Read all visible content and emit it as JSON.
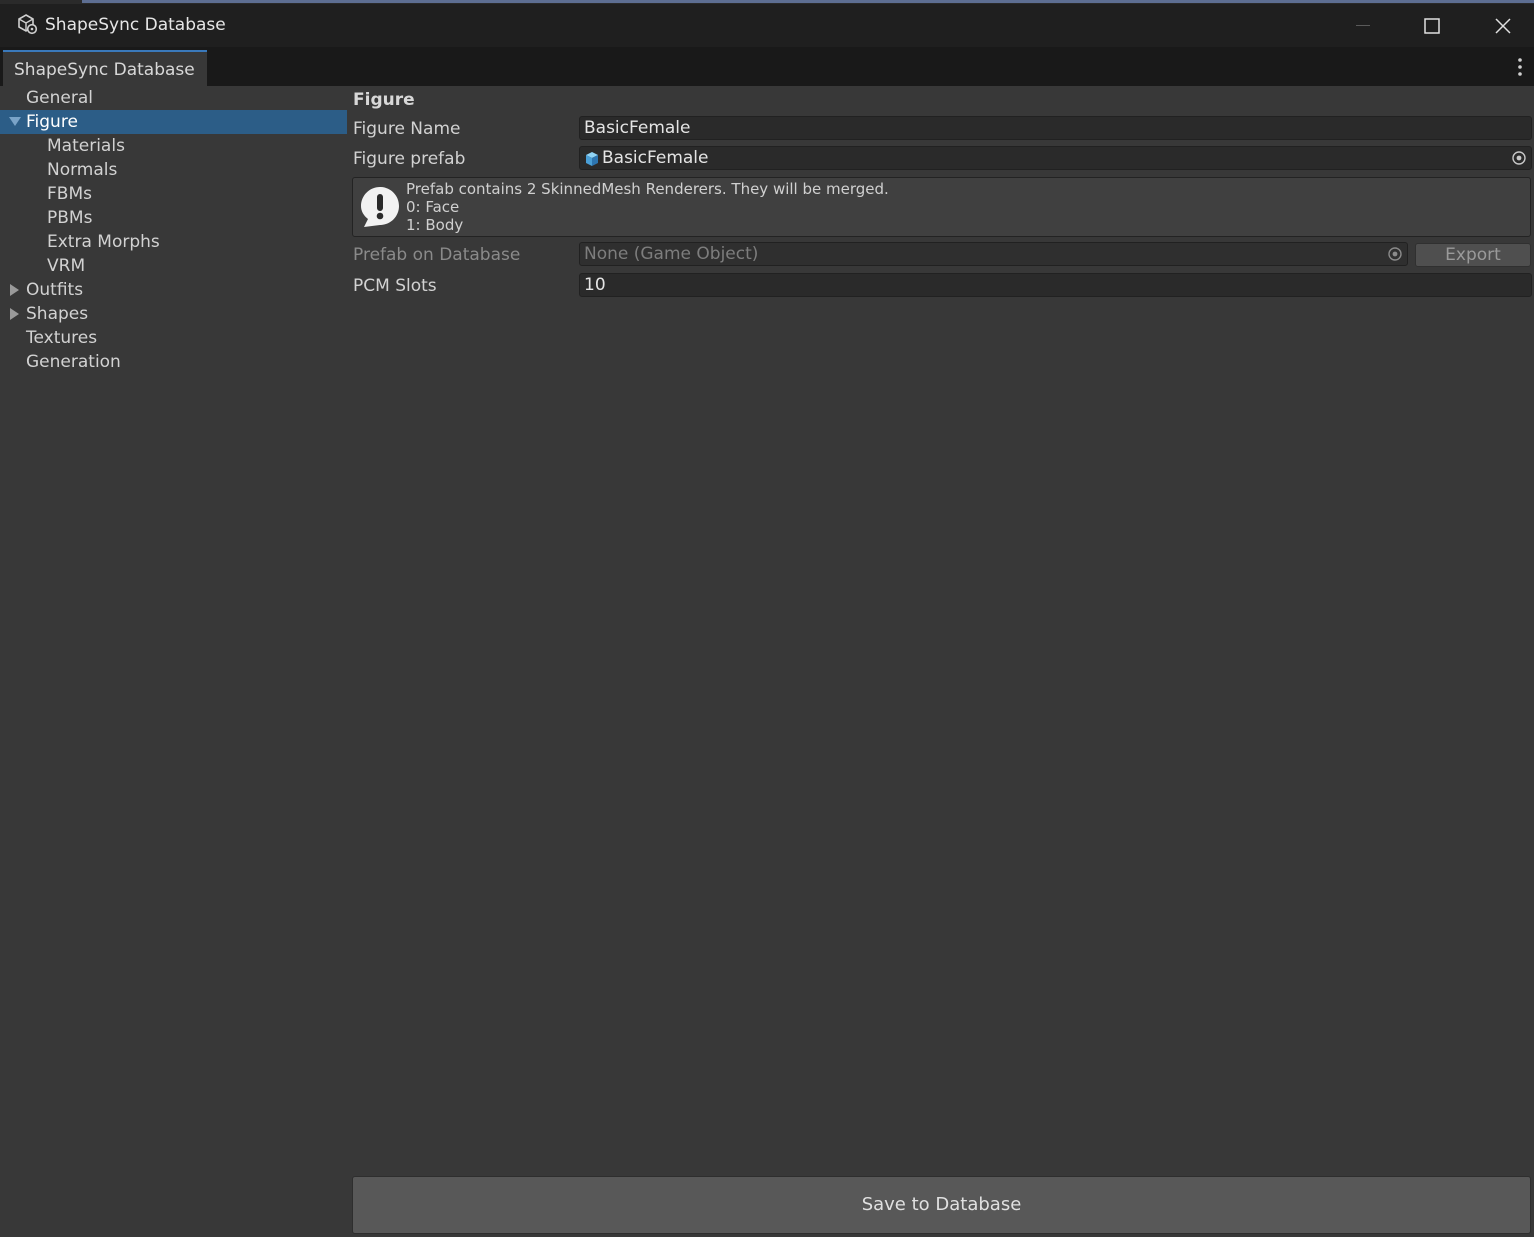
{
  "window": {
    "title": "ShapeSync Database",
    "icon": "unity-cube-gear-icon",
    "controls": [
      "minimize-icon",
      "maximize-icon",
      "close-icon"
    ]
  },
  "tab": {
    "label": "ShapeSync Database",
    "menu_icon": "kebab-menu-icon"
  },
  "tree": {
    "items": [
      {
        "label": "General",
        "level": 0,
        "expander": "none",
        "selected": false
      },
      {
        "label": "Figure",
        "level": 0,
        "expander": "expanded",
        "selected": true
      },
      {
        "label": "Materials",
        "level": 1,
        "expander": "none",
        "selected": false
      },
      {
        "label": "Normals",
        "level": 1,
        "expander": "none",
        "selected": false
      },
      {
        "label": "FBMs",
        "level": 1,
        "expander": "none",
        "selected": false
      },
      {
        "label": "PBMs",
        "level": 1,
        "expander": "none",
        "selected": false
      },
      {
        "label": "Extra Morphs",
        "level": 1,
        "expander": "none",
        "selected": false
      },
      {
        "label": "VRM",
        "level": 1,
        "expander": "none",
        "selected": false
      },
      {
        "label": "Outfits",
        "level": 0,
        "expander": "collapsed",
        "selected": false
      },
      {
        "label": "Shapes",
        "level": 0,
        "expander": "collapsed",
        "selected": false
      },
      {
        "label": "Textures",
        "level": 0,
        "expander": "none",
        "selected": false
      },
      {
        "label": "Generation",
        "level": 0,
        "expander": "none",
        "selected": false
      }
    ]
  },
  "panel": {
    "section_title": "Figure",
    "figure_name": {
      "label": "Figure Name",
      "value": "BasicFemale"
    },
    "figure_prefab": {
      "label": "Figure prefab",
      "value": "BasicFemale",
      "icon": "prefab-cube-icon"
    },
    "help": {
      "icon": "warning-exclamation-icon",
      "lines": [
        "Prefab contains 2 SkinnedMesh Renderers. They will be merged.",
        "0: Face",
        "1: Body"
      ]
    },
    "prefab_on_database": {
      "label": "Prefab on Database",
      "value": "None (Game Object)",
      "button": "Export"
    },
    "pcm_slots": {
      "label": "PCM Slots",
      "value": "10"
    },
    "save_button": "Save to Database"
  },
  "colors": {
    "background": "#383838",
    "selection": "#2c5d87",
    "titlebar": "#1f1f1f",
    "tab_accent": "#3a79bb"
  }
}
